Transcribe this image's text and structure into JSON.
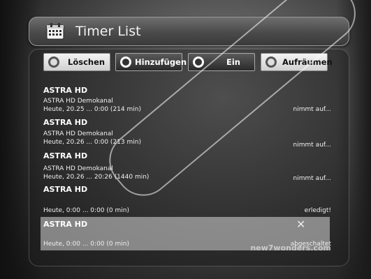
{
  "window": {
    "title": "Timer List"
  },
  "toolbar": {
    "buttons": [
      {
        "label": "Löschen",
        "active": false
      },
      {
        "label": "Hinzufügen",
        "active": true
      },
      {
        "label": "Ein",
        "active": true
      },
      {
        "label": "Aufräumen",
        "active": false
      }
    ]
  },
  "timers": [
    {
      "channel": "ASTRA HD",
      "program": "ASTRA HD Demokanal",
      "time": "Heute, 20.25 ... 0:00 (214 min)",
      "status": "nimmt auf..."
    },
    {
      "channel": "ASTRA HD",
      "program": "ASTRA HD Demokanal",
      "time": "Heute, 20.26 ... 0:00 (213 min)",
      "status": "nimmt auf..."
    },
    {
      "channel": "ASTRA HD",
      "program": "ASTRA HD Demokanal",
      "time": "Heute, 20.26 ... 20:26 (1440 min)",
      "status": "nimmt auf..."
    },
    {
      "channel": "ASTRA HD",
      "program": "",
      "time": "Heute, 0:00 ... 0:00 (0 min)",
      "status": "erledigt!"
    },
    {
      "channel": "ASTRA HD",
      "program": "",
      "time": "Heute, 0:00 ... 0:00 (0 min)",
      "status": "abgeschaltet"
    }
  ],
  "overlay": {
    "watermark": "new7wonders.com"
  },
  "icons": {
    "calendar": "calendar-icon",
    "close": "close-icon"
  }
}
